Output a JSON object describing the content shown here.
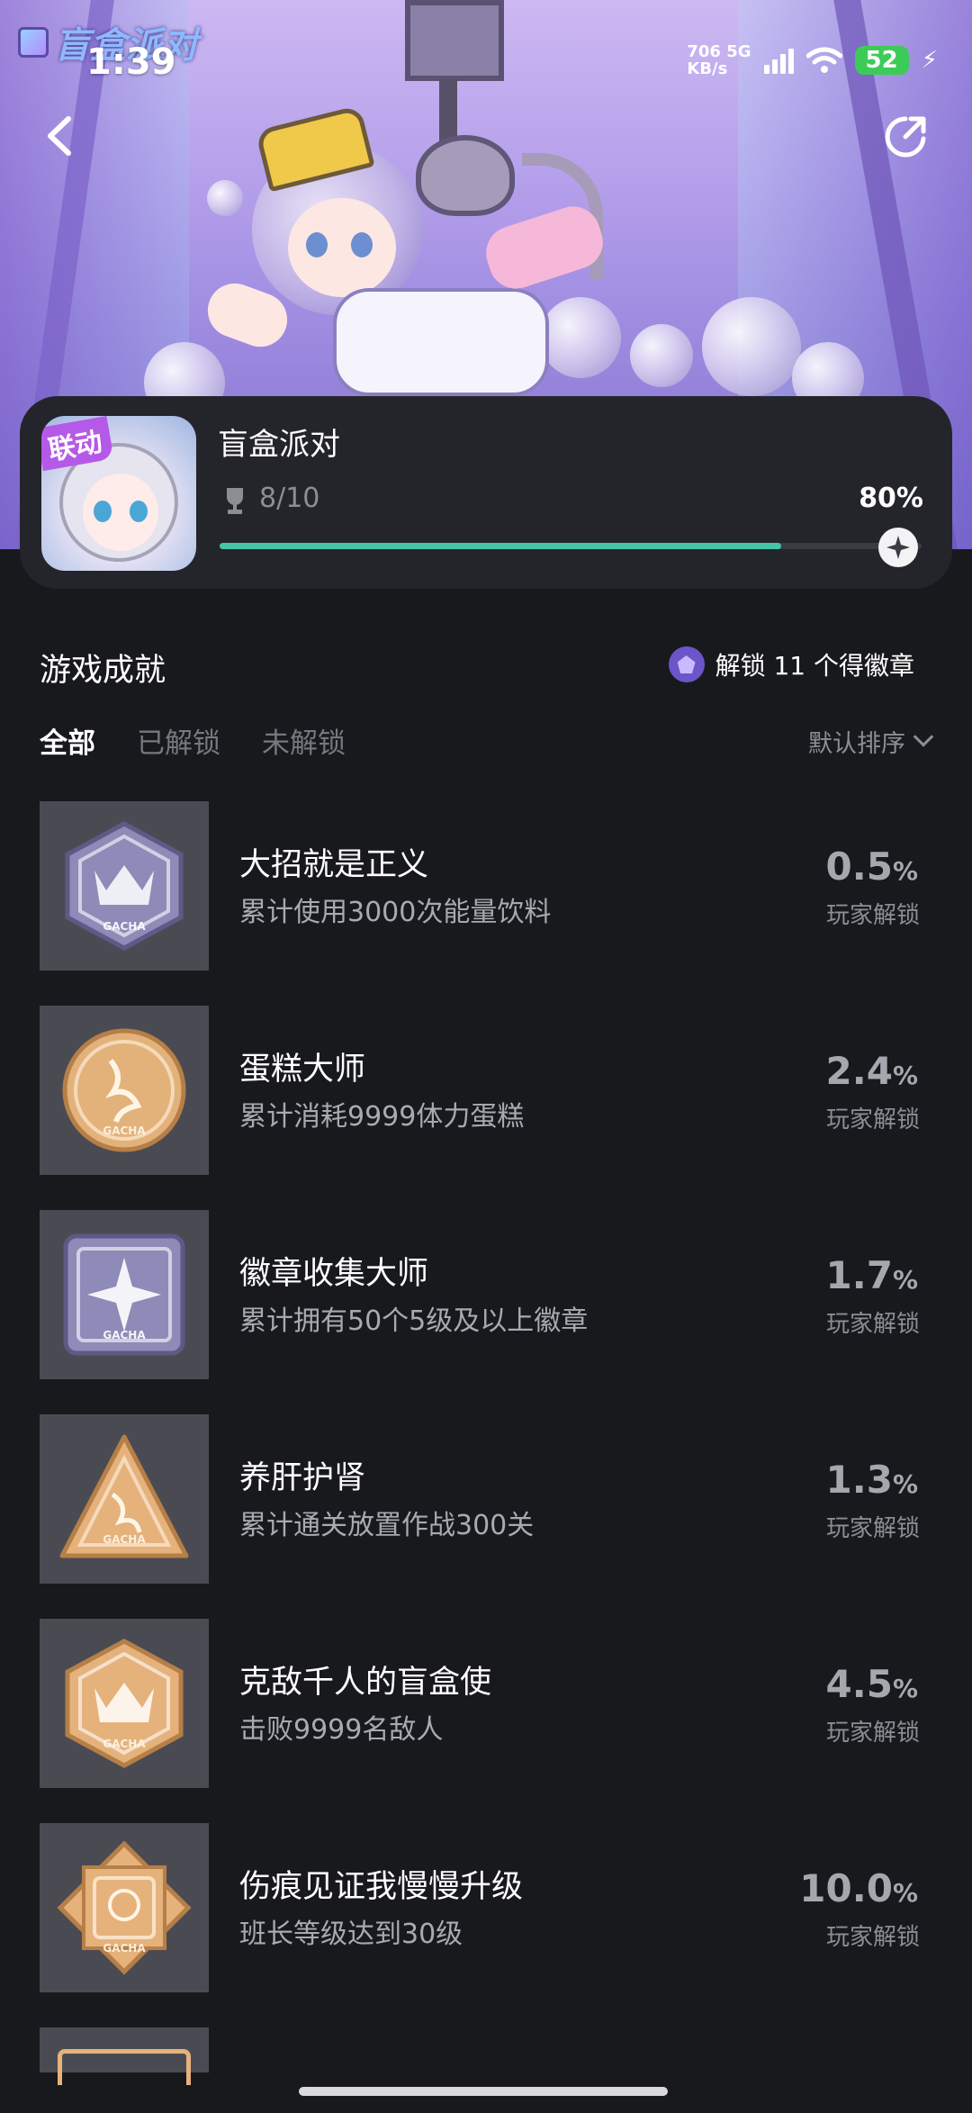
{
  "status_bar": {
    "time": "1:39",
    "net_speed_value": "706",
    "net_speed_unit": "KB/s",
    "network_type": "5G",
    "battery": "52"
  },
  "hero": {
    "logo_text": "盲盒派对"
  },
  "game": {
    "tag": "联动",
    "name": "盲盒派对",
    "progress_text": "8/10",
    "progress_percent_text": "80%",
    "progress_fraction": 0.8
  },
  "section": {
    "title": "游戏成就",
    "unlock_info": "解锁 11 个得徽章"
  },
  "filters": {
    "all": "全部",
    "unlocked": "已解锁",
    "locked": "未解锁",
    "sort": "默认排序"
  },
  "achievements": [
    {
      "name": "大招就是正义",
      "desc": "累计使用3000次能量饮料",
      "pct": "0.5",
      "unit": "%",
      "sub": "玩家解锁",
      "badge": "hexagon-crown-silver",
      "color": "#8e8bb8"
    },
    {
      "name": "蛋糕大师",
      "desc": "累计消耗9999体力蛋糕",
      "pct": "2.4",
      "unit": "%",
      "sub": "玩家解锁",
      "badge": "circle-gold",
      "color": "#e3b27a"
    },
    {
      "name": "徽章收集大师",
      "desc": "累计拥有50个5级及以上徽章",
      "pct": "1.7",
      "unit": "%",
      "sub": "玩家解锁",
      "badge": "square-star-silver",
      "color": "#8e8bb8"
    },
    {
      "name": "养肝护肾",
      "desc": "累计通关放置作战300关",
      "pct": "1.3",
      "unit": "%",
      "sub": "玩家解锁",
      "badge": "triangle-gold",
      "color": "#e6b27c"
    },
    {
      "name": "克敌千人的盲盒使",
      "desc": "击败9999名敌人",
      "pct": "4.5",
      "unit": "%",
      "sub": "玩家解锁",
      "badge": "hexagon-crown-gold",
      "color": "#e6b27c"
    },
    {
      "name": "伤痕见证我慢慢升级",
      "desc": "班长等级达到30级",
      "pct": "10.0",
      "unit": "%",
      "sub": "玩家解锁",
      "badge": "octagon-gold",
      "color": "#e6b27c"
    }
  ],
  "gacha_label": "GACHA"
}
